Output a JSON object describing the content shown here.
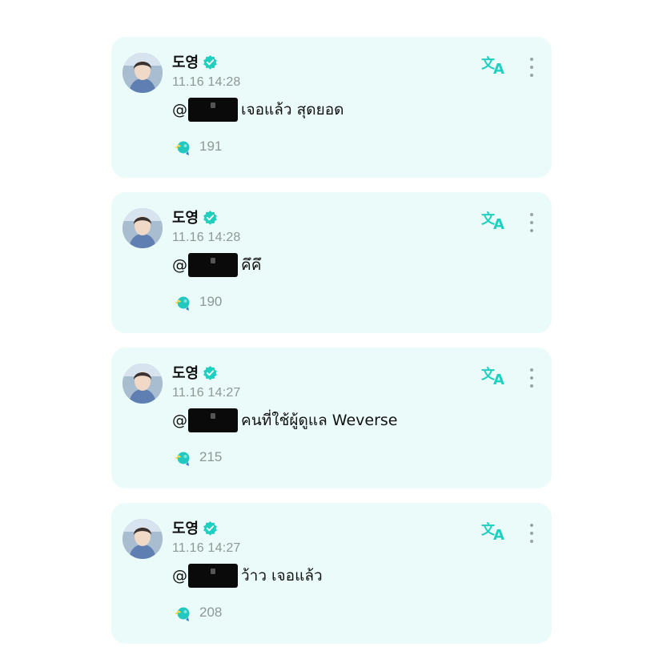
{
  "colors": {
    "card_background": "#ebfbf9",
    "accent": "#1fcfc0",
    "text": "#111111",
    "muted": "#8d9894"
  },
  "comments": [
    {
      "author": "도영",
      "verified": true,
      "time": "11.16 14:28",
      "mention_prefix": "@",
      "text": "เจอแล้ว สุดยอด",
      "likes": "191",
      "icons": [
        "avatar",
        "verified-badge-icon",
        "translate-icon",
        "more-icon",
        "like-icon"
      ]
    },
    {
      "author": "도영",
      "verified": true,
      "time": "11.16 14:28",
      "mention_prefix": "@",
      "text": "คึคึ",
      "likes": "190",
      "icons": [
        "avatar",
        "verified-badge-icon",
        "translate-icon",
        "more-icon",
        "like-icon"
      ]
    },
    {
      "author": "도영",
      "verified": true,
      "time": "11.16 14:27",
      "mention_prefix": "@",
      "text": "คนที่ใช้ผู้ดูแล Weverse",
      "likes": "215",
      "icons": [
        "avatar",
        "verified-badge-icon",
        "translate-icon",
        "more-icon",
        "like-icon"
      ]
    },
    {
      "author": "도영",
      "verified": true,
      "time": "11.16 14:27",
      "mention_prefix": "@",
      "text": "ว้าว เจอแล้ว",
      "likes": "208",
      "icons": [
        "avatar",
        "verified-badge-icon",
        "translate-icon",
        "more-icon",
        "like-icon"
      ]
    }
  ]
}
